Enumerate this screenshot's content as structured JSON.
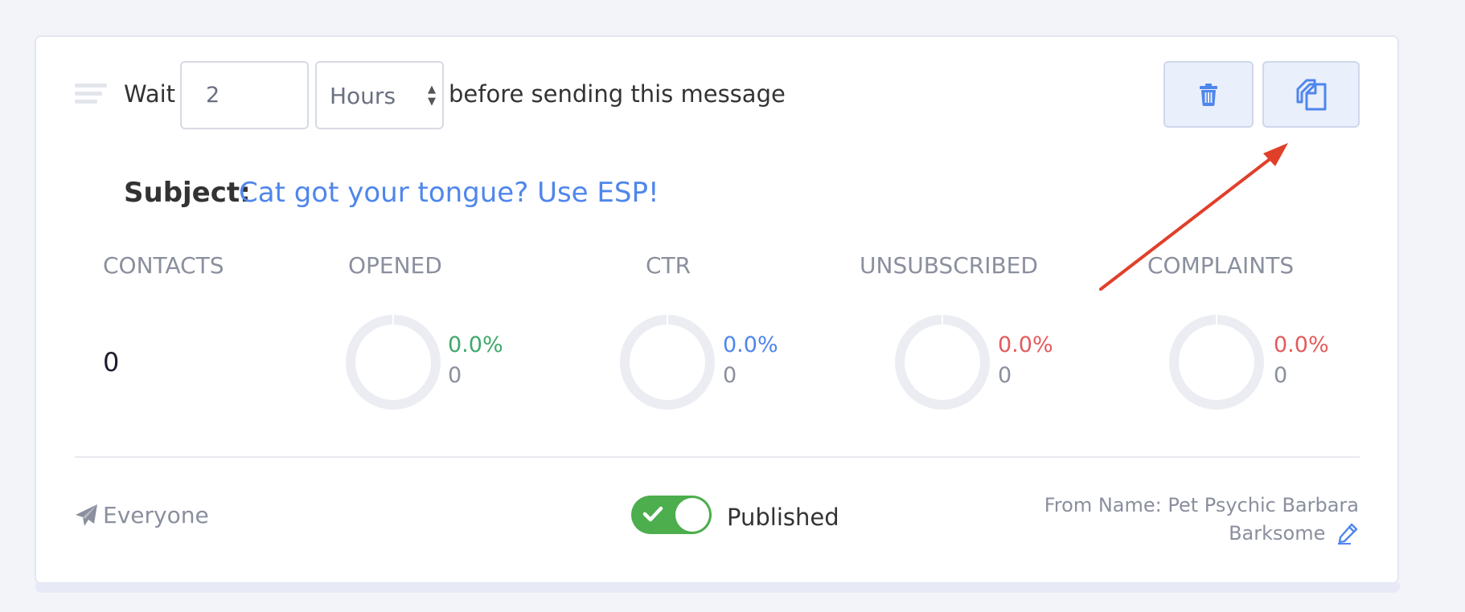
{
  "step": {
    "wait_label": "Wait",
    "delay_value": "2",
    "delay_unit": "Hours",
    "delay_unit_options": [
      "Hours"
    ],
    "after_label": "before sending this message"
  },
  "actions": {
    "delete_icon": "trash-icon",
    "duplicate_icon": "copy-icon"
  },
  "subject": {
    "label": "Subject:",
    "value": "Cat got your tongue? Use ESP!"
  },
  "stats": {
    "contacts": {
      "label": "CONTACTS",
      "value": "0"
    },
    "opened": {
      "label": "OPENED",
      "percent": "0.0%",
      "count": "0",
      "color": "#3ea96b"
    },
    "ctr": {
      "label": "CTR",
      "percent": "0.0%",
      "count": "0",
      "color": "#4f86ec"
    },
    "unsubscribed": {
      "label": "UNSUBSCRIBED",
      "percent": "0.0%",
      "count": "0",
      "color": "#e35b5b"
    },
    "complaints": {
      "label": "COMPLAINTS",
      "percent": "0.0%",
      "count": "0",
      "color": "#e35b5b"
    }
  },
  "footer": {
    "audience_icon": "paper-plane-icon",
    "audience": "Everyone",
    "published_label": "Published",
    "published": true,
    "from_name_line1": "From Name: Pet Psychic Barbara",
    "from_name_line2": "Barksome",
    "edit_icon": "pencil-icon"
  },
  "colors": {
    "accent": "#4f86ec",
    "toggle_on": "#4cae4c",
    "annotation_arrow": "#e0402a"
  }
}
